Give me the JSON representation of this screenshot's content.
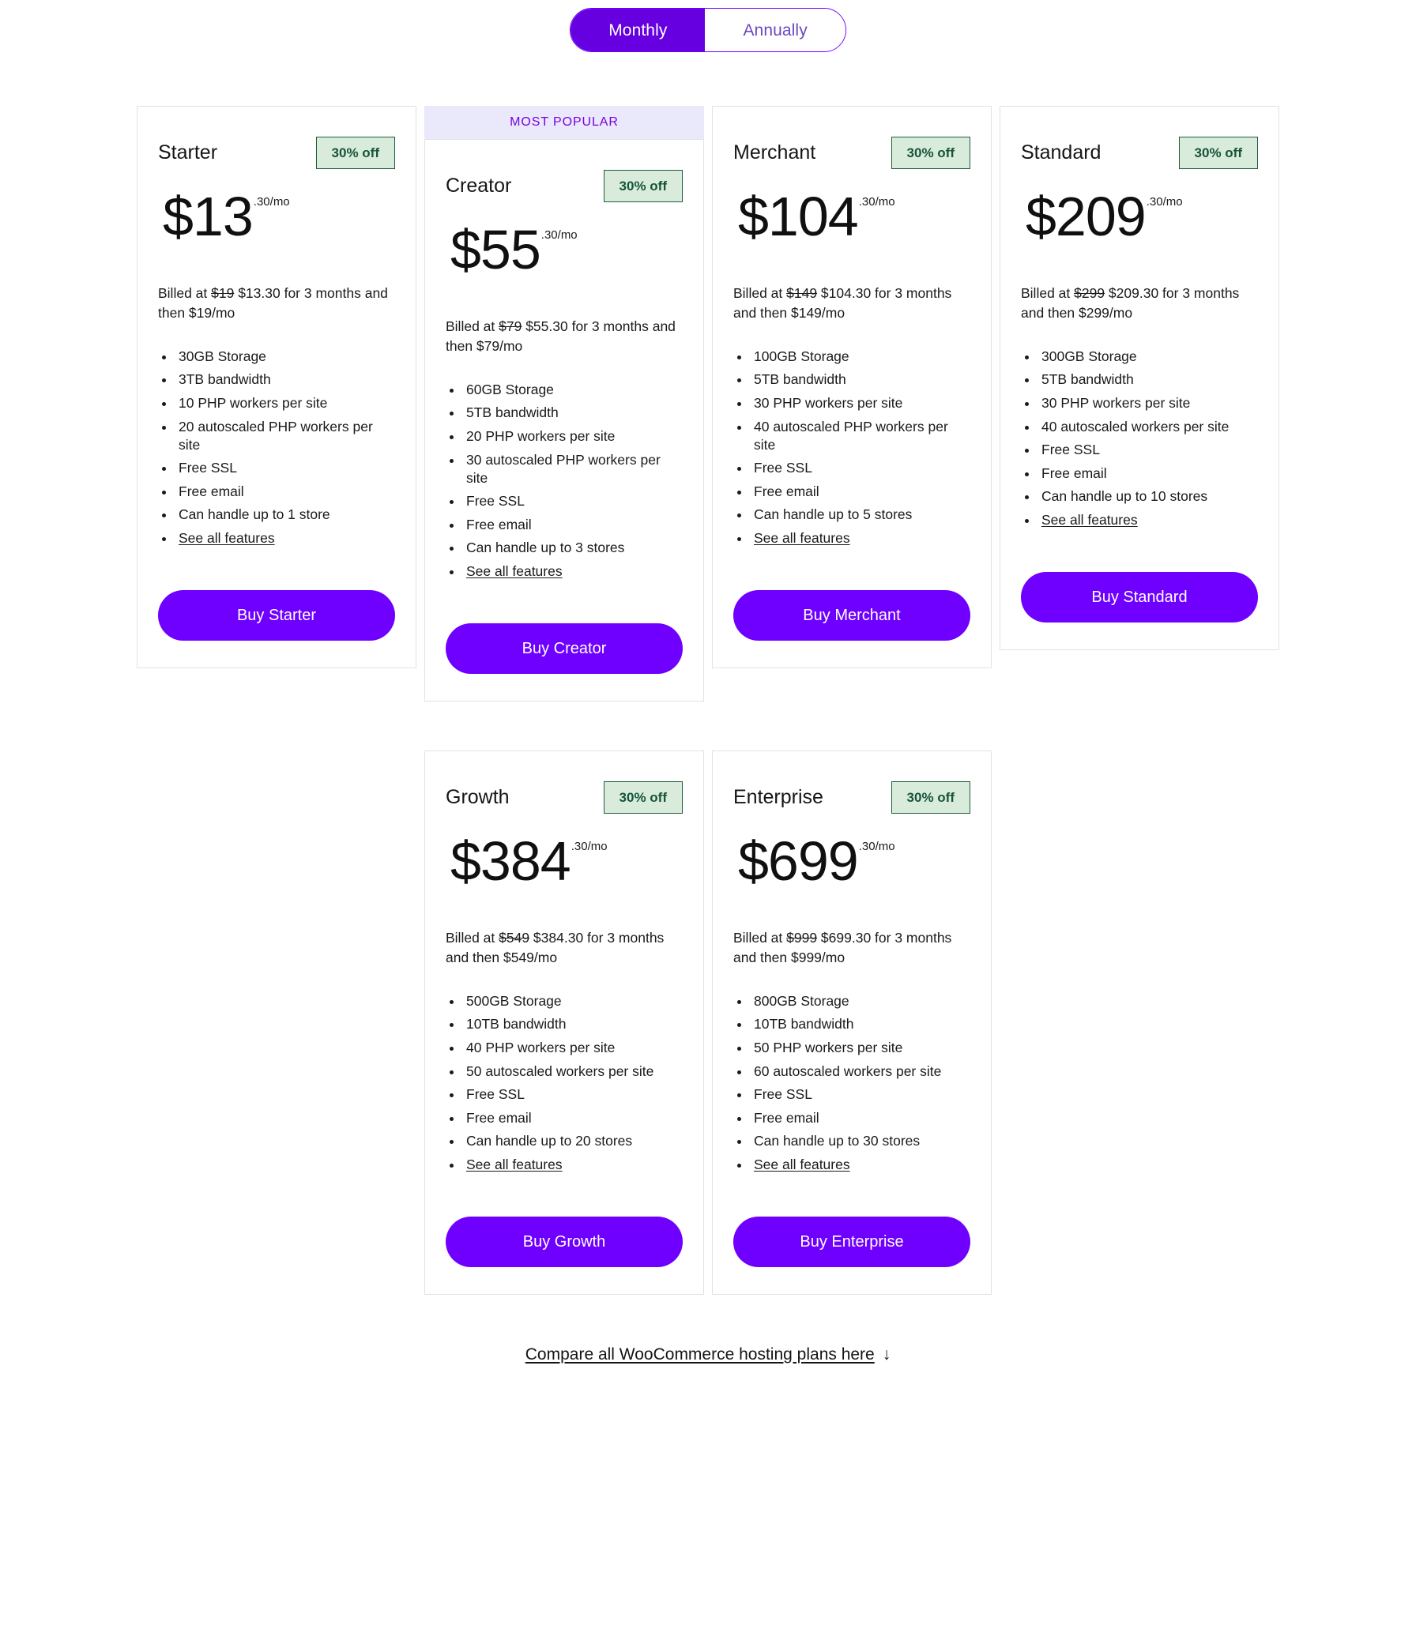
{
  "colors": {
    "accent": "#6f00ff",
    "accent_toggle": "#6600e0",
    "popular_bg": "#e9e9fb",
    "popular_text": "#7b00e0",
    "badge_bg": "#d9ecdc",
    "badge_border": "#1c5c3c",
    "badge_text": "#16543a",
    "card_border": "#e2e2e2",
    "text": "#1a1a1a"
  },
  "billing_toggle": {
    "name": "billing-period-toggle",
    "options": [
      {
        "label": "Monthly",
        "selected": true
      },
      {
        "label": "Annually",
        "selected": false
      }
    ]
  },
  "popular_badge_label": "MOST POPULAR",
  "plans": [
    {
      "name": "Starter",
      "discount": "30% off",
      "price": "$13",
      "price_suffix": ".30/mo",
      "billing_prefix": "Billed at ",
      "billing_old_price": "$19",
      "billing_rest": " $13.30 for 3 months and then $19/mo",
      "features": [
        "30GB Storage",
        "3TB bandwidth",
        "10 PHP workers per site",
        "20 autoscaled PHP workers per site",
        "Free SSL",
        "Free email",
        "Can handle up to 1 store"
      ],
      "see_all_label": "See all features",
      "cta": "Buy Starter",
      "most_popular": false
    },
    {
      "name": "Creator",
      "discount": "30% off",
      "price": "$55",
      "price_suffix": ".30/mo",
      "billing_prefix": "Billed at ",
      "billing_old_price": "$79",
      "billing_rest": " $55.30 for 3 months and then $79/mo",
      "features": [
        "60GB Storage",
        "5TB bandwidth",
        "20 PHP workers per site",
        "30 autoscaled PHP workers per site",
        "Free SSL",
        "Free email",
        "Can handle up to 3 stores"
      ],
      "see_all_label": "See all features",
      "cta": "Buy Creator",
      "most_popular": true
    },
    {
      "name": "Merchant",
      "discount": "30% off",
      "price": "$104",
      "price_suffix": ".30/mo",
      "billing_prefix": "Billed at ",
      "billing_old_price": "$149",
      "billing_rest": " $104.30 for 3 months and then $149/mo",
      "features": [
        "100GB Storage",
        "5TB bandwidth",
        "30 PHP workers per site",
        "40 autoscaled PHP workers per site",
        "Free SSL",
        "Free email",
        "Can handle up to 5 stores"
      ],
      "see_all_label": "See all features",
      "cta": "Buy Merchant",
      "most_popular": false
    },
    {
      "name": "Standard",
      "discount": "30% off",
      "price": "$209",
      "price_suffix": ".30/mo",
      "billing_prefix": "Billed at ",
      "billing_old_price": "$299",
      "billing_rest": " $209.30 for 3 months and then $299/mo",
      "features": [
        "300GB Storage",
        "5TB bandwidth",
        "30 PHP workers per site",
        "40 autoscaled workers per site",
        "Free SSL",
        "Free email",
        "Can handle up to 10 stores"
      ],
      "see_all_label": "See all features",
      "cta": "Buy Standard",
      "most_popular": false
    },
    {
      "name": "Growth",
      "discount": "30% off",
      "price": "$384",
      "price_suffix": ".30/mo",
      "billing_prefix": "Billed at ",
      "billing_old_price": "$549",
      "billing_rest": " $384.30 for 3 months and then $549/mo",
      "features": [
        "500GB Storage",
        "10TB bandwidth",
        "40 PHP workers per site",
        "50 autoscaled workers per site",
        "Free SSL",
        "Free email",
        "Can handle up to 20 stores"
      ],
      "see_all_label": "See all features",
      "cta": "Buy Growth",
      "most_popular": false
    },
    {
      "name": "Enterprise",
      "discount": "30% off",
      "price": "$699",
      "price_suffix": ".30/mo",
      "billing_prefix": "Billed at ",
      "billing_old_price": "$999",
      "billing_rest": " $699.30 for 3 months and then $999/mo",
      "features": [
        "800GB Storage",
        "10TB bandwidth",
        "50 PHP workers per site",
        "60 autoscaled workers per site",
        "Free SSL",
        "Free email",
        "Can handle up to 30 stores"
      ],
      "see_all_label": "See all features",
      "cta": "Buy Enterprise",
      "most_popular": false
    }
  ],
  "footer": {
    "compare_link_text": "Compare all WooCommerce hosting plans here",
    "compare_link_arrow": "↓"
  }
}
